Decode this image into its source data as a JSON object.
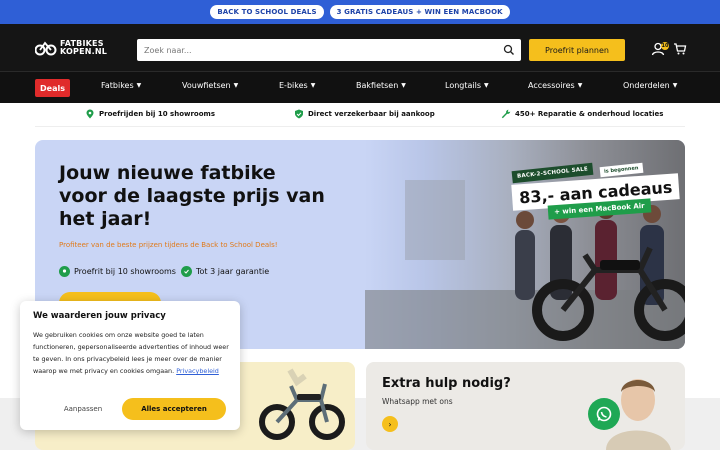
{
  "topbar": {
    "pills": [
      "BACK TO SCHOOL DEALS",
      "3 GRATIS CADEAUS + WIN EEN MACBOOK"
    ]
  },
  "header": {
    "logo_line1": "FATBIKES",
    "logo_line2": "KOPEN.NL",
    "search_placeholder": "Zoek naar...",
    "cta_label": "Proefrit plannen",
    "account_badge": "10"
  },
  "nav": {
    "deals_label": "Deals",
    "items": [
      "Fatbikes",
      "Vouwfietsen",
      "E-bikes",
      "Bakfietsen",
      "Longtails",
      "Accessoires",
      "Onderdelen"
    ]
  },
  "usp": {
    "items": [
      "Proefrijden bij 10 showrooms",
      "Direct verzekerbaar bij aankoop",
      "450+ Reparatie & onderhoud locaties"
    ]
  },
  "hero": {
    "title": "Jouw nieuwe fatbike voor de laagste prijs van het jaar!",
    "subtitle": "Profiteer van de beste prijzen tijdens de Back to School Deals!",
    "usps": [
      "Proefrit bij 10 showrooms",
      "Tot 3 jaar garantie"
    ],
    "promo_tag": "BACK-2-SCHOOL SALE",
    "promo_tag2": "is begonnen",
    "promo_main": "83,- aan cadeaus",
    "promo_sub": "+ win een MacBook Air"
  },
  "cards": {
    "help_title": "Extra hulp nodig?",
    "help_sub": "Whatsapp met ons"
  },
  "cookie": {
    "title": "We waarderen jouw privacy",
    "body": "We gebruiken cookies om onze website goed te laten functioneren, gepersonaliseerde advertenties of inhoud weer te geven. In ons privacybeleid lees je meer over de manier waarop we met privacy en cookies omgaan.",
    "link": "Privacybeleid",
    "deny_label": "Aanpassen",
    "accept_label": "Alles accepteren"
  },
  "colors": {
    "accent_yellow": "#f5bf1c",
    "topbar_blue": "#2f5fd6",
    "deals_red": "#e02b2b",
    "hero_bg": "#c9d5f5",
    "subtitle_orange": "#e07a1a",
    "check_green": "#1f9d4a"
  }
}
